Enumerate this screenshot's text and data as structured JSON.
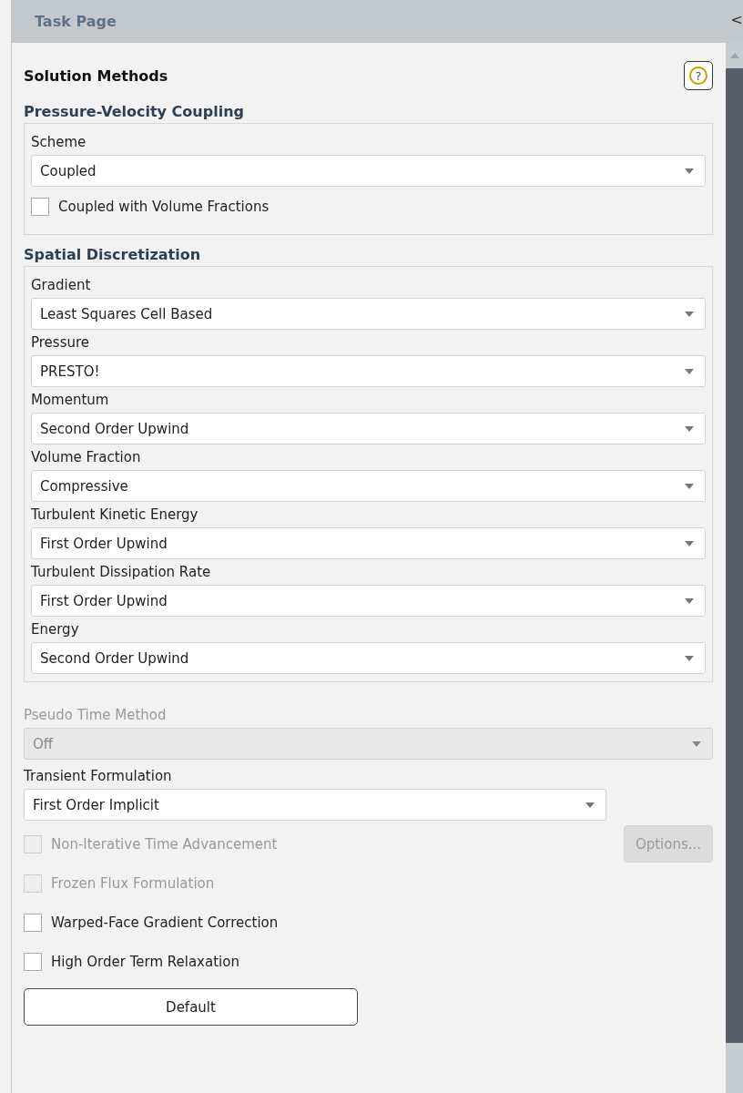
{
  "window": {
    "title": "Task Page",
    "collapse_glyph": "<"
  },
  "panel": {
    "title": "Solution Methods",
    "help_glyph": "?"
  },
  "groups": [
    {
      "title": "Pressure-Velocity Coupling",
      "fields": [
        {
          "kind": "dropdown",
          "label": "Scheme",
          "value": "Coupled",
          "disabled": false
        },
        {
          "kind": "checkbox",
          "label": "Coupled with Volume Fractions",
          "checked": false,
          "disabled": false
        }
      ]
    },
    {
      "title": "Spatial Discretization",
      "fields": [
        {
          "kind": "dropdown",
          "label": "Gradient",
          "value": "Least Squares Cell Based",
          "disabled": false
        },
        {
          "kind": "dropdown",
          "label": "Pressure",
          "value": "PRESTO!",
          "disabled": false
        },
        {
          "kind": "dropdown",
          "label": "Momentum",
          "value": "Second Order Upwind",
          "disabled": false
        },
        {
          "kind": "dropdown",
          "label": "Volume Fraction",
          "value": "Compressive",
          "disabled": false
        },
        {
          "kind": "dropdown",
          "label": "Turbulent Kinetic Energy",
          "value": "First Order Upwind",
          "disabled": false
        },
        {
          "kind": "dropdown",
          "label": "Turbulent Dissipation Rate",
          "value": "First Order Upwind",
          "disabled": false
        },
        {
          "kind": "dropdown",
          "label": "Energy",
          "value": "Second Order Upwind",
          "disabled": false
        }
      ]
    }
  ],
  "fields": [
    {
      "kind": "dropdown",
      "label": "Pseudo Time Method",
      "value": "Off",
      "disabled": true
    },
    {
      "kind": "short_dropdown",
      "label": "Transient Formulation",
      "value": "First Order Implicit",
      "disabled": false
    },
    {
      "kind": "checkbox",
      "label": "Non-Iterative Time Advancement",
      "checked": false,
      "disabled": true,
      "button": {
        "label": "Options...",
        "disabled": true
      }
    },
    {
      "kind": "checkbox",
      "label": "Frozen Flux Formulation",
      "checked": false,
      "disabled": true
    },
    {
      "kind": "checkbox",
      "label": "Warped-Face Gradient Correction",
      "checked": false,
      "disabled": false
    },
    {
      "kind": "checkbox",
      "label": "High Order Term Relaxation",
      "checked": false,
      "disabled": false
    }
  ],
  "buttons": [
    "Default"
  ]
}
